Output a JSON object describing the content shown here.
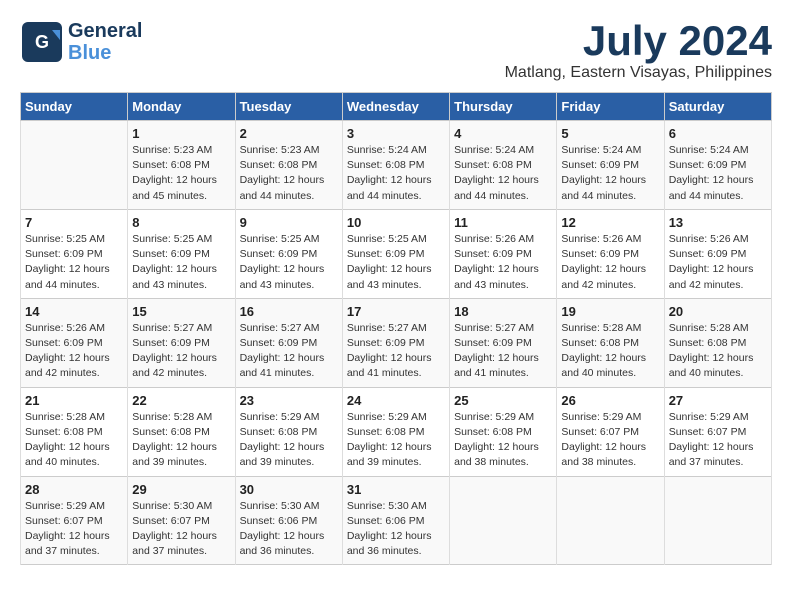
{
  "logo": {
    "line1": "General",
    "line2": "Blue"
  },
  "title": {
    "month": "July 2024",
    "location": "Matlang, Eastern Visayas, Philippines"
  },
  "headers": [
    "Sunday",
    "Monday",
    "Tuesday",
    "Wednesday",
    "Thursday",
    "Friday",
    "Saturday"
  ],
  "weeks": [
    [
      {
        "day": "",
        "info": ""
      },
      {
        "day": "1",
        "info": "Sunrise: 5:23 AM\nSunset: 6:08 PM\nDaylight: 12 hours\nand 45 minutes."
      },
      {
        "day": "2",
        "info": "Sunrise: 5:23 AM\nSunset: 6:08 PM\nDaylight: 12 hours\nand 44 minutes."
      },
      {
        "day": "3",
        "info": "Sunrise: 5:24 AM\nSunset: 6:08 PM\nDaylight: 12 hours\nand 44 minutes."
      },
      {
        "day": "4",
        "info": "Sunrise: 5:24 AM\nSunset: 6:08 PM\nDaylight: 12 hours\nand 44 minutes."
      },
      {
        "day": "5",
        "info": "Sunrise: 5:24 AM\nSunset: 6:09 PM\nDaylight: 12 hours\nand 44 minutes."
      },
      {
        "day": "6",
        "info": "Sunrise: 5:24 AM\nSunset: 6:09 PM\nDaylight: 12 hours\nand 44 minutes."
      }
    ],
    [
      {
        "day": "7",
        "info": "Sunrise: 5:25 AM\nSunset: 6:09 PM\nDaylight: 12 hours\nand 44 minutes."
      },
      {
        "day": "8",
        "info": "Sunrise: 5:25 AM\nSunset: 6:09 PM\nDaylight: 12 hours\nand 43 minutes."
      },
      {
        "day": "9",
        "info": "Sunrise: 5:25 AM\nSunset: 6:09 PM\nDaylight: 12 hours\nand 43 minutes."
      },
      {
        "day": "10",
        "info": "Sunrise: 5:25 AM\nSunset: 6:09 PM\nDaylight: 12 hours\nand 43 minutes."
      },
      {
        "day": "11",
        "info": "Sunrise: 5:26 AM\nSunset: 6:09 PM\nDaylight: 12 hours\nand 43 minutes."
      },
      {
        "day": "12",
        "info": "Sunrise: 5:26 AM\nSunset: 6:09 PM\nDaylight: 12 hours\nand 42 minutes."
      },
      {
        "day": "13",
        "info": "Sunrise: 5:26 AM\nSunset: 6:09 PM\nDaylight: 12 hours\nand 42 minutes."
      }
    ],
    [
      {
        "day": "14",
        "info": "Sunrise: 5:26 AM\nSunset: 6:09 PM\nDaylight: 12 hours\nand 42 minutes."
      },
      {
        "day": "15",
        "info": "Sunrise: 5:27 AM\nSunset: 6:09 PM\nDaylight: 12 hours\nand 42 minutes."
      },
      {
        "day": "16",
        "info": "Sunrise: 5:27 AM\nSunset: 6:09 PM\nDaylight: 12 hours\nand 41 minutes."
      },
      {
        "day": "17",
        "info": "Sunrise: 5:27 AM\nSunset: 6:09 PM\nDaylight: 12 hours\nand 41 minutes."
      },
      {
        "day": "18",
        "info": "Sunrise: 5:27 AM\nSunset: 6:09 PM\nDaylight: 12 hours\nand 41 minutes."
      },
      {
        "day": "19",
        "info": "Sunrise: 5:28 AM\nSunset: 6:08 PM\nDaylight: 12 hours\nand 40 minutes."
      },
      {
        "day": "20",
        "info": "Sunrise: 5:28 AM\nSunset: 6:08 PM\nDaylight: 12 hours\nand 40 minutes."
      }
    ],
    [
      {
        "day": "21",
        "info": "Sunrise: 5:28 AM\nSunset: 6:08 PM\nDaylight: 12 hours\nand 40 minutes."
      },
      {
        "day": "22",
        "info": "Sunrise: 5:28 AM\nSunset: 6:08 PM\nDaylight: 12 hours\nand 39 minutes."
      },
      {
        "day": "23",
        "info": "Sunrise: 5:29 AM\nSunset: 6:08 PM\nDaylight: 12 hours\nand 39 minutes."
      },
      {
        "day": "24",
        "info": "Sunrise: 5:29 AM\nSunset: 6:08 PM\nDaylight: 12 hours\nand 39 minutes."
      },
      {
        "day": "25",
        "info": "Sunrise: 5:29 AM\nSunset: 6:08 PM\nDaylight: 12 hours\nand 38 minutes."
      },
      {
        "day": "26",
        "info": "Sunrise: 5:29 AM\nSunset: 6:07 PM\nDaylight: 12 hours\nand 38 minutes."
      },
      {
        "day": "27",
        "info": "Sunrise: 5:29 AM\nSunset: 6:07 PM\nDaylight: 12 hours\nand 37 minutes."
      }
    ],
    [
      {
        "day": "28",
        "info": "Sunrise: 5:29 AM\nSunset: 6:07 PM\nDaylight: 12 hours\nand 37 minutes."
      },
      {
        "day": "29",
        "info": "Sunrise: 5:30 AM\nSunset: 6:07 PM\nDaylight: 12 hours\nand 37 minutes."
      },
      {
        "day": "30",
        "info": "Sunrise: 5:30 AM\nSunset: 6:06 PM\nDaylight: 12 hours\nand 36 minutes."
      },
      {
        "day": "31",
        "info": "Sunrise: 5:30 AM\nSunset: 6:06 PM\nDaylight: 12 hours\nand 36 minutes."
      },
      {
        "day": "",
        "info": ""
      },
      {
        "day": "",
        "info": ""
      },
      {
        "day": "",
        "info": ""
      }
    ]
  ]
}
